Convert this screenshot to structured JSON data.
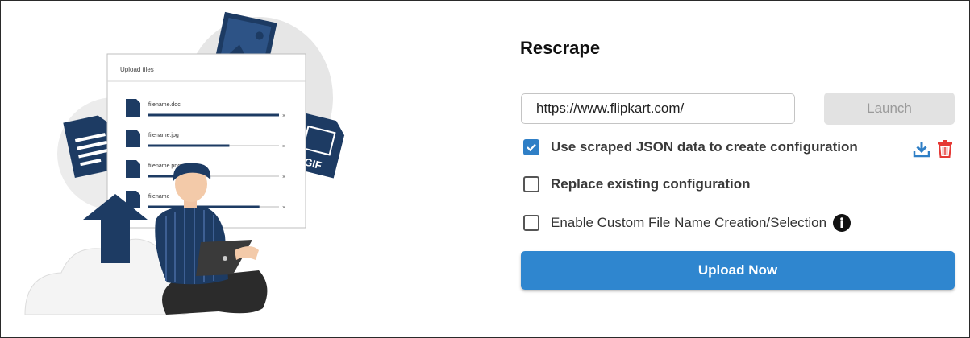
{
  "illustration": {
    "upload_title": "Upload files",
    "files": [
      {
        "name": "filename.doc",
        "progress": 1.0
      },
      {
        "name": "filename.jpg",
        "progress": 0.62
      },
      {
        "name": "filename.png",
        "progress": 0.22
      },
      {
        "name": "filename",
        "progress": 0.85
      }
    ],
    "gif_label": "GIF"
  },
  "rescrape": {
    "title": "Rescrape",
    "url_value": "https://www.flipkart.com/",
    "launch_label": "Launch",
    "options": [
      {
        "label": "Use scraped JSON data to create configuration",
        "checked": true
      },
      {
        "label": "Replace existing configuration",
        "checked": false
      },
      {
        "label": "Enable Custom File Name Creation/Selection",
        "checked": false
      }
    ],
    "upload_label": "Upload Now"
  },
  "colors": {
    "primary": "#2f86cf",
    "check_blue": "#2f7fc6",
    "delete_red": "#e53935",
    "navy": "#1d3b63"
  }
}
